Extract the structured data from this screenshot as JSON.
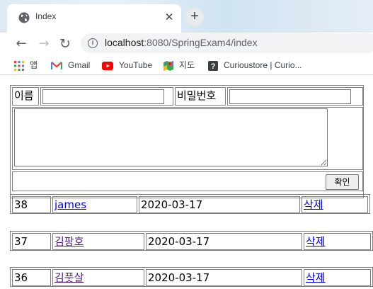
{
  "browser": {
    "tab": {
      "title": "Index",
      "close_glyph": "✕"
    },
    "new_tab_glyph": "+",
    "nav": {
      "back_glyph": "←",
      "forward_glyph": "→",
      "reload_glyph": "↻"
    },
    "address": {
      "host": "localhost",
      "path": ":8080/SpringExam4/index"
    },
    "bookmarks": [
      {
        "label": "앱",
        "icon": "apps-grid-icon"
      },
      {
        "label": "Gmail",
        "icon": "gmail-icon"
      },
      {
        "label": "YouTube",
        "icon": "youtube-icon"
      },
      {
        "label": "지도",
        "icon": "maps-icon"
      },
      {
        "label": "Curioustore | Curio...",
        "icon": "curioustore-icon"
      }
    ]
  },
  "form": {
    "name_label": "이름",
    "name_value": "",
    "password_label": "비밀번호",
    "password_value": "",
    "content_value": "",
    "submit_label": "확인"
  },
  "entries": [
    {
      "id": "38",
      "name": "james",
      "date": "2020-03-17",
      "delete_label": "삭제",
      "visited": false
    },
    {
      "id": "37",
      "name": "김팡호",
      "date": "2020-03-17",
      "delete_label": "삭제",
      "visited": true
    },
    {
      "id": "36",
      "name": "김풋살",
      "date": "2020-03-17",
      "delete_label": "삭제",
      "visited": true
    }
  ],
  "colors": {
    "link": "#0000ee",
    "visited_link": "#551a8b",
    "table_border": "#808080"
  }
}
